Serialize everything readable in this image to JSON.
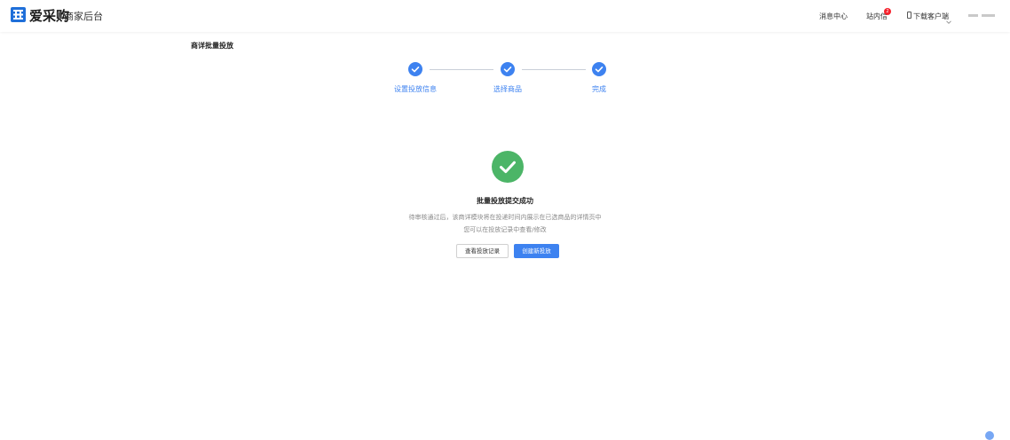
{
  "header": {
    "logo_text": "爱采购",
    "subtitle": "商家后台",
    "nav": {
      "message_center": "消息中心",
      "site_mail": "站内信",
      "site_mail_badge": "2",
      "download_client": "下载客户端"
    }
  },
  "page": {
    "title": "商详批量投放"
  },
  "steps": [
    {
      "label": "设置投放信息",
      "status": "done"
    },
    {
      "label": "选择商品",
      "status": "done"
    },
    {
      "label": "完成",
      "status": "done"
    }
  ],
  "result": {
    "title": "批量投放提交成功",
    "desc_line1": "待审核通过后，该商详模块将在投递时间内展示在已选商品的详情页中",
    "desc_line2": "您可以在投放记录中查看/修改",
    "btn_view_records": "查看投放记录",
    "btn_create_new": "创建新投放"
  },
  "colors": {
    "accent": "#3d82f0",
    "success": "#4cb567",
    "logo": "#1f6fd9"
  }
}
